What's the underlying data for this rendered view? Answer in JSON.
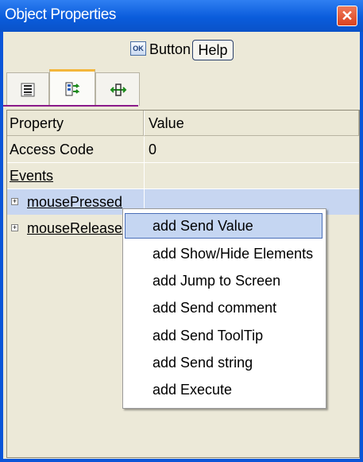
{
  "window": {
    "title": "Object Properties",
    "close_glyph": "✕"
  },
  "header": {
    "ok_icon": "OK",
    "object_label": "Button",
    "help_label": "Help"
  },
  "tabs": [
    {
      "icon": "list-icon",
      "active": false
    },
    {
      "icon": "events-icon",
      "active": true
    },
    {
      "icon": "move-icon",
      "active": false
    }
  ],
  "table": {
    "columns": [
      "Property",
      "Value"
    ],
    "rows": [
      {
        "property": "Access Code",
        "value": "0"
      },
      {
        "property": "Events",
        "value": ""
      },
      {
        "property": "mousePressed",
        "value": ""
      },
      {
        "property": "mouseRelease",
        "value": ""
      }
    ]
  },
  "context_menu": {
    "items": [
      "add Send Value",
      "add Show/Hide Elements",
      "add Jump to Screen",
      "add Send comment",
      "add Send ToolTip",
      "add Send string",
      "add Execute"
    ]
  },
  "colors": {
    "titlebar": "#0a5cdc",
    "client": "#ece9d8",
    "selection": "#c5d6f2",
    "tab_accent": "#f3b63b"
  }
}
